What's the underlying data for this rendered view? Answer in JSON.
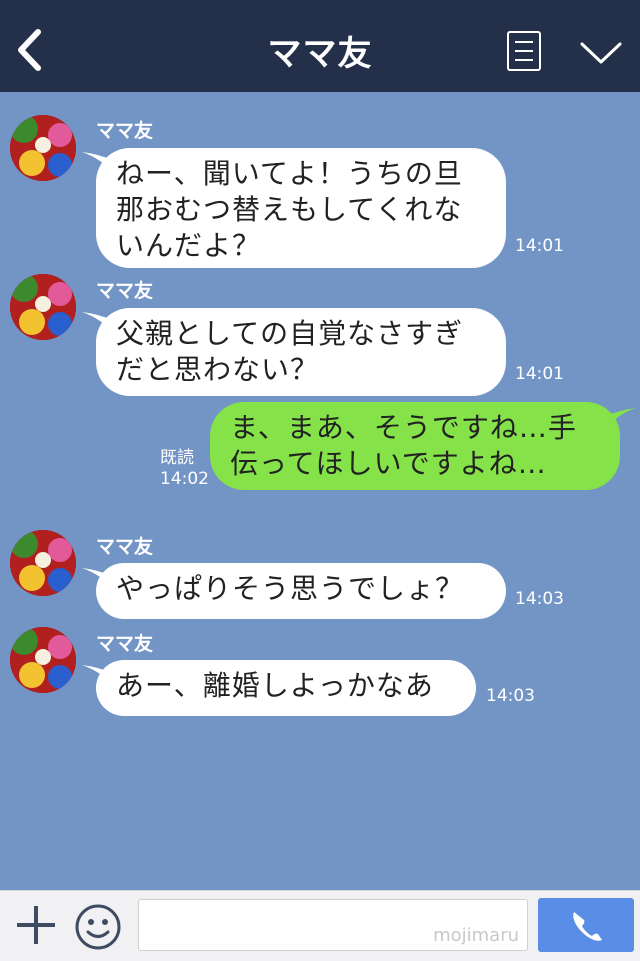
{
  "header": {
    "back_icon": "chevron-left-icon",
    "title": "ママ友",
    "menu_icon": "list-icon",
    "expand_icon": "chevron-down-icon"
  },
  "messages": [
    {
      "sender": "ママ友",
      "lines": [
        "ねー、聞いてよ！うちの旦",
        "那おむつ替えもしてくれな",
        "いんだよ？"
      ],
      "time": "14:01"
    },
    {
      "sender": "ママ友",
      "lines": [
        "父親としての自覚なさすぎ",
        "だと思わない？"
      ],
      "time": "14:01"
    },
    {
      "direction": "out",
      "lines": [
        "ま、まあ、そうですね…手",
        "伝ってほしいですよね…"
      ],
      "read": "既読",
      "time": "14:02"
    },
    {
      "sender": "ママ友",
      "lines": [
        "やっぱりそう思うでしょ？"
      ],
      "time": "14:03"
    },
    {
      "sender": "ママ友",
      "lines": [
        "あー、離婚しよっかなあ"
      ],
      "time": "14:03"
    }
  ],
  "footer": {
    "plus_icon": "plus-icon",
    "emoji_icon": "smiley-icon",
    "input_value": "",
    "watermark": "mojimaru",
    "call_icon": "phone-icon"
  },
  "colors": {
    "header_bg": "#24304a",
    "chat_bg": "#7395c5",
    "incoming_bubble": "#ffffff",
    "outgoing_bubble": "#85e249",
    "call_button": "#5a8ee6"
  }
}
